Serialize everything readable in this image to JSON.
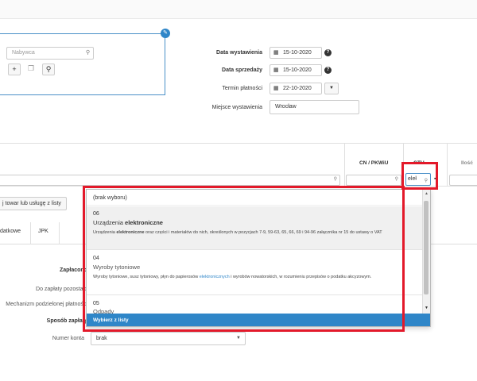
{
  "buyer": {
    "placeholder": "Nabywca"
  },
  "dates": {
    "issue_label": "Data wystawienia",
    "issue_value": "15-10-2020",
    "sale_label": "Data sprzedaży",
    "sale_value": "15-10-2020",
    "payment_label": "Termin płatności",
    "payment_value": "22-10-2020",
    "place_label": "Miejsce wystawienia",
    "place_value": "Wrocław"
  },
  "table": {
    "col_cn": "CN / PKWiU",
    "col_gtu": "GTU",
    "col_qty": "Ilość",
    "gtu_input_value": "eleł"
  },
  "toolbar": {
    "add_item_label": "j towar lub usługę z listy"
  },
  "tabs": [
    {
      "label": "datkowe"
    },
    {
      "label": "JPK"
    }
  ],
  "payment": {
    "paid_label": "Zapłacono",
    "to_pay_label": "Do zapłaty pozostało",
    "split_label": "Mechanizm podzielonej płatności",
    "method_label": "Sposób zapłaty",
    "account_label": "Numer konta",
    "account_value": "brak"
  },
  "dropdown": {
    "empty_option": "(brak wyboru)",
    "options": [
      {
        "code": "06",
        "name_pre": "Urządzenia ",
        "name_bold": "elektroniczne",
        "desc_pre": "Urządzenia ",
        "desc_bold": "elektroniczne",
        "desc_post": " oraz części i materiałów do nich, określonych w pozycjach 7-9, 59-63, 65, 66, 69 i 94-96 załącznika nr 15 do ustawy o VAT"
      },
      {
        "code": "04",
        "name": "Wyroby tytoniowe",
        "desc_pre": "Wyroby tytoniowe, susz tytoniowy, płyn do papierosów ",
        "desc_link": "elektronicznych",
        "desc_post": " i wyrobów nowatorskich, w rozumieniu przepisów o podatku akcyzowym."
      },
      {
        "code": "05",
        "name": "Odpady"
      }
    ],
    "footer": "Wybierz z listy"
  }
}
